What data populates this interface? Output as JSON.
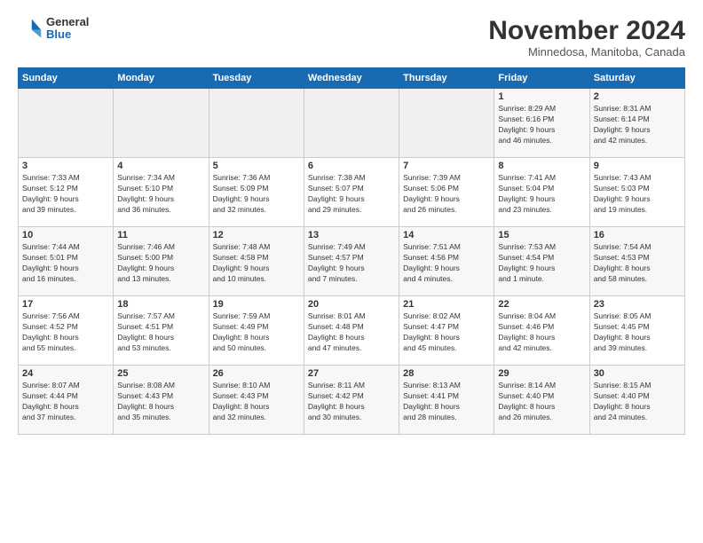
{
  "logo": {
    "general": "General",
    "blue": "Blue"
  },
  "title": "November 2024",
  "subtitle": "Minnedosa, Manitoba, Canada",
  "days_header": [
    "Sunday",
    "Monday",
    "Tuesday",
    "Wednesday",
    "Thursday",
    "Friday",
    "Saturday"
  ],
  "weeks": [
    [
      {
        "day": "",
        "info": ""
      },
      {
        "day": "",
        "info": ""
      },
      {
        "day": "",
        "info": ""
      },
      {
        "day": "",
        "info": ""
      },
      {
        "day": "",
        "info": ""
      },
      {
        "day": "1",
        "info": "Sunrise: 8:29 AM\nSunset: 6:16 PM\nDaylight: 9 hours\nand 46 minutes."
      },
      {
        "day": "2",
        "info": "Sunrise: 8:31 AM\nSunset: 6:14 PM\nDaylight: 9 hours\nand 42 minutes."
      }
    ],
    [
      {
        "day": "3",
        "info": "Sunrise: 7:33 AM\nSunset: 5:12 PM\nDaylight: 9 hours\nand 39 minutes."
      },
      {
        "day": "4",
        "info": "Sunrise: 7:34 AM\nSunset: 5:10 PM\nDaylight: 9 hours\nand 36 minutes."
      },
      {
        "day": "5",
        "info": "Sunrise: 7:36 AM\nSunset: 5:09 PM\nDaylight: 9 hours\nand 32 minutes."
      },
      {
        "day": "6",
        "info": "Sunrise: 7:38 AM\nSunset: 5:07 PM\nDaylight: 9 hours\nand 29 minutes."
      },
      {
        "day": "7",
        "info": "Sunrise: 7:39 AM\nSunset: 5:06 PM\nDaylight: 9 hours\nand 26 minutes."
      },
      {
        "day": "8",
        "info": "Sunrise: 7:41 AM\nSunset: 5:04 PM\nDaylight: 9 hours\nand 23 minutes."
      },
      {
        "day": "9",
        "info": "Sunrise: 7:43 AM\nSunset: 5:03 PM\nDaylight: 9 hours\nand 19 minutes."
      }
    ],
    [
      {
        "day": "10",
        "info": "Sunrise: 7:44 AM\nSunset: 5:01 PM\nDaylight: 9 hours\nand 16 minutes."
      },
      {
        "day": "11",
        "info": "Sunrise: 7:46 AM\nSunset: 5:00 PM\nDaylight: 9 hours\nand 13 minutes."
      },
      {
        "day": "12",
        "info": "Sunrise: 7:48 AM\nSunset: 4:58 PM\nDaylight: 9 hours\nand 10 minutes."
      },
      {
        "day": "13",
        "info": "Sunrise: 7:49 AM\nSunset: 4:57 PM\nDaylight: 9 hours\nand 7 minutes."
      },
      {
        "day": "14",
        "info": "Sunrise: 7:51 AM\nSunset: 4:56 PM\nDaylight: 9 hours\nand 4 minutes."
      },
      {
        "day": "15",
        "info": "Sunrise: 7:53 AM\nSunset: 4:54 PM\nDaylight: 9 hours\nand 1 minute."
      },
      {
        "day": "16",
        "info": "Sunrise: 7:54 AM\nSunset: 4:53 PM\nDaylight: 8 hours\nand 58 minutes."
      }
    ],
    [
      {
        "day": "17",
        "info": "Sunrise: 7:56 AM\nSunset: 4:52 PM\nDaylight: 8 hours\nand 55 minutes."
      },
      {
        "day": "18",
        "info": "Sunrise: 7:57 AM\nSunset: 4:51 PM\nDaylight: 8 hours\nand 53 minutes."
      },
      {
        "day": "19",
        "info": "Sunrise: 7:59 AM\nSunset: 4:49 PM\nDaylight: 8 hours\nand 50 minutes."
      },
      {
        "day": "20",
        "info": "Sunrise: 8:01 AM\nSunset: 4:48 PM\nDaylight: 8 hours\nand 47 minutes."
      },
      {
        "day": "21",
        "info": "Sunrise: 8:02 AM\nSunset: 4:47 PM\nDaylight: 8 hours\nand 45 minutes."
      },
      {
        "day": "22",
        "info": "Sunrise: 8:04 AM\nSunset: 4:46 PM\nDaylight: 8 hours\nand 42 minutes."
      },
      {
        "day": "23",
        "info": "Sunrise: 8:05 AM\nSunset: 4:45 PM\nDaylight: 8 hours\nand 39 minutes."
      }
    ],
    [
      {
        "day": "24",
        "info": "Sunrise: 8:07 AM\nSunset: 4:44 PM\nDaylight: 8 hours\nand 37 minutes."
      },
      {
        "day": "25",
        "info": "Sunrise: 8:08 AM\nSunset: 4:43 PM\nDaylight: 8 hours\nand 35 minutes."
      },
      {
        "day": "26",
        "info": "Sunrise: 8:10 AM\nSunset: 4:43 PM\nDaylight: 8 hours\nand 32 minutes."
      },
      {
        "day": "27",
        "info": "Sunrise: 8:11 AM\nSunset: 4:42 PM\nDaylight: 8 hours\nand 30 minutes."
      },
      {
        "day": "28",
        "info": "Sunrise: 8:13 AM\nSunset: 4:41 PM\nDaylight: 8 hours\nand 28 minutes."
      },
      {
        "day": "29",
        "info": "Sunrise: 8:14 AM\nSunset: 4:40 PM\nDaylight: 8 hours\nand 26 minutes."
      },
      {
        "day": "30",
        "info": "Sunrise: 8:15 AM\nSunset: 4:40 PM\nDaylight: 8 hours\nand 24 minutes."
      }
    ]
  ]
}
